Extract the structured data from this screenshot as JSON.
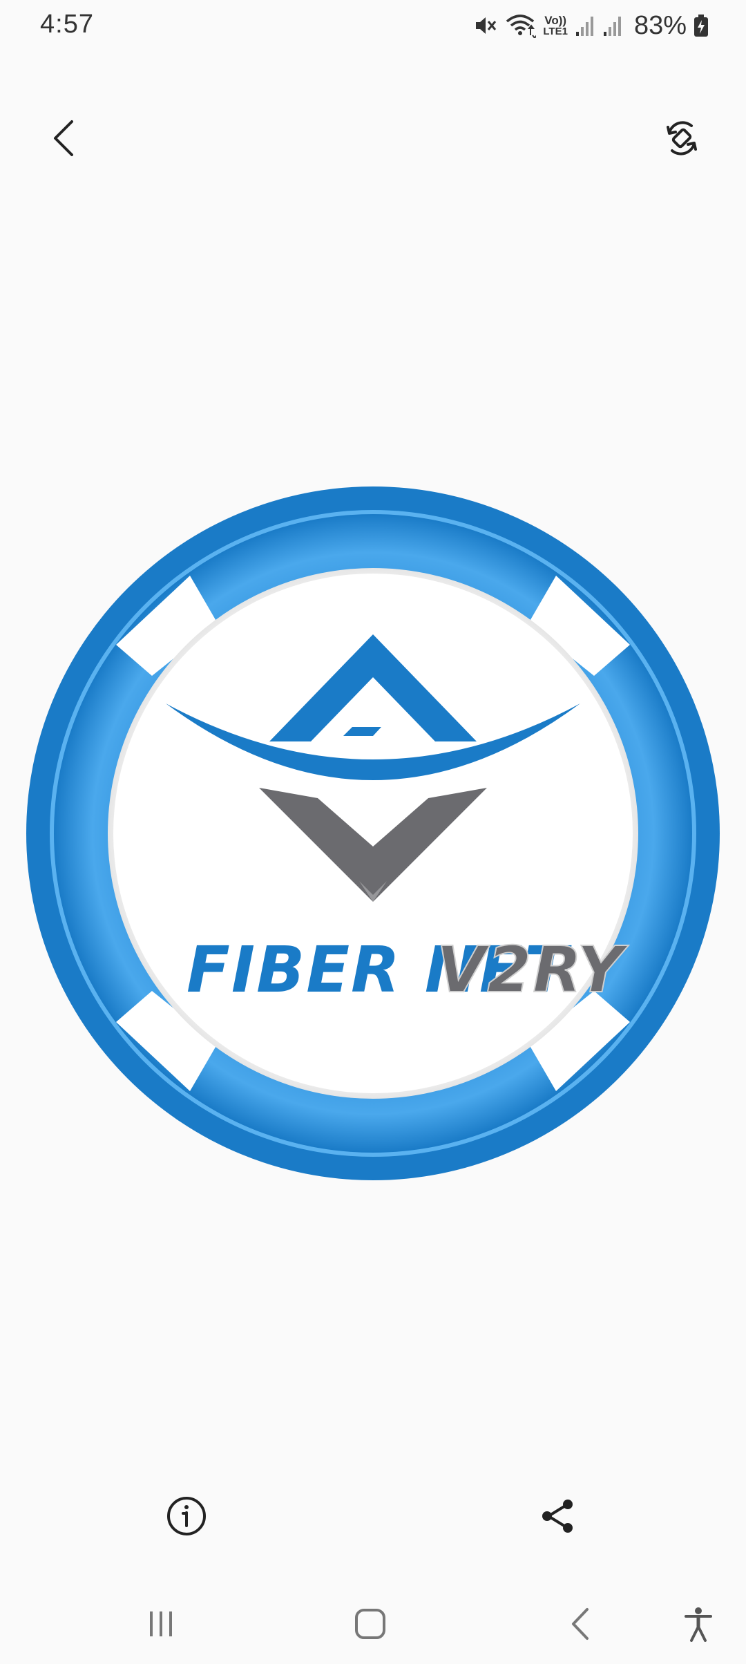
{
  "status_bar": {
    "time": "4:57",
    "battery_percent": "83%",
    "icons": [
      "mute-icon",
      "wifi-icon",
      "volte-icon",
      "signal-icon",
      "signal-icon-2",
      "battery-charging-icon"
    ],
    "network_label_top": "Vo))",
    "network_label_bottom": "LTE1"
  },
  "toolbar": {
    "back_icon": "chevron-left-icon",
    "rotate_icon": "rotate-screen-icon"
  },
  "image": {
    "logo_word_1": "FIBER NET",
    "logo_word_2": "V2RY",
    "colors": {
      "blue_dark": "#1a7bc7",
      "blue_light": "#4aa8ec",
      "gray": "#6b6b6f",
      "white": "#ffffff"
    }
  },
  "actions": {
    "info_icon": "info-icon",
    "share_icon": "share-icon"
  },
  "nav_bar": {
    "recents_icon": "recents-icon",
    "home_icon": "home-icon",
    "back_icon": "nav-back-icon",
    "accessibility_icon": "accessibility-icon"
  }
}
